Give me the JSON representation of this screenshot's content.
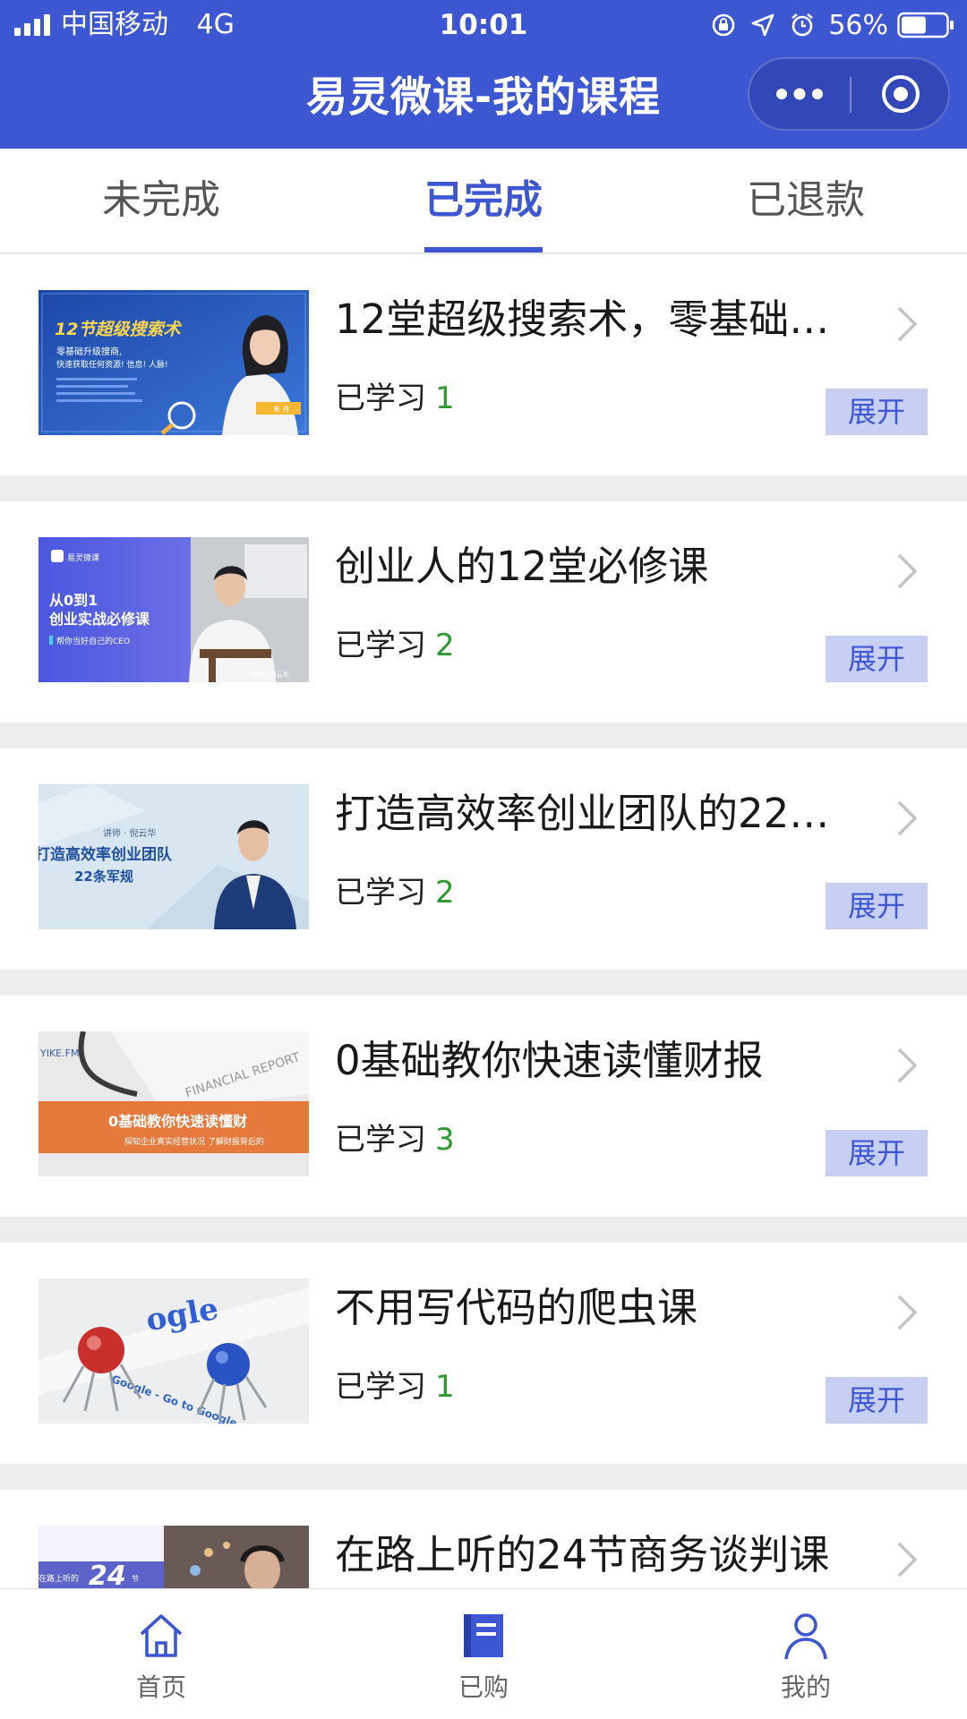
{
  "status_bar": {
    "carrier": "中国移动",
    "network": "4G",
    "time": "10:01",
    "battery_percent": "56%",
    "battery_level": 0.56,
    "icons": [
      "signal-icon",
      "orientation-lock-icon",
      "location-icon",
      "alarm-icon",
      "battery-icon"
    ]
  },
  "nav": {
    "title": "易灵微课-我的课程",
    "more_icon": "more-dots-icon",
    "close_icon": "target-circle-icon"
  },
  "tabs": [
    {
      "label": "未完成",
      "active": false
    },
    {
      "label": "已完成",
      "active": true
    },
    {
      "label": "已退款",
      "active": false
    }
  ],
  "course_progress_label": "已学习",
  "expand_label": "展开",
  "courses": [
    {
      "title": "12堂超级搜索术，零基础…",
      "progress": "1",
      "thumb": {
        "headline": "12节超级搜索术",
        "line1": "零基础升级搜商,",
        "line2": "快速获取任何资源! 信息! 人脉!",
        "tag": "朱 丹"
      }
    },
    {
      "title": "创业人的12堂必修课",
      "progress": "2",
      "thumb": {
        "brand": "易灵微课",
        "line1": "从0到1",
        "line2": "创业实战必修课",
        "line3": "帮你当好自己的CEO",
        "tag": "讲师 · 倪云华"
      }
    },
    {
      "title": "打造高效率创业团队的22…",
      "progress": "2",
      "thumb": {
        "tag": "讲师 · 倪云华",
        "line1": "打造高效率创业团队",
        "line2": "22条军规"
      }
    },
    {
      "title": "0基础教你快速读懂财报",
      "progress": "3",
      "thumb": {
        "brand": "YIKE.FM",
        "paper": "FINANCIAL REPORT",
        "line1": "0基础教你快速读懂财",
        "line2": "探知企业真实经营状况 了解财报背后的"
      }
    },
    {
      "title": "不用写代码的爬虫课",
      "progress": "1",
      "thumb": {
        "line1": "Google - Go to Google",
        "logo": "ogle"
      }
    },
    {
      "title": "在路上听的24节商务谈判课",
      "progress": "",
      "thumb": {
        "num": "24",
        "unit": "节",
        "line1": "在路上听的"
      }
    }
  ],
  "bottom_tabs": [
    {
      "label": "首页",
      "icon": "home-icon",
      "active": false
    },
    {
      "label": "已购",
      "icon": "book-icon",
      "active": true
    },
    {
      "label": "我的",
      "icon": "user-icon",
      "active": false
    }
  ],
  "colors": {
    "brand_blue": "#3d57d3",
    "expand_bg": "#c7d0f3",
    "progress_green": "#2f9a2f",
    "page_bg": "#ededf0"
  }
}
